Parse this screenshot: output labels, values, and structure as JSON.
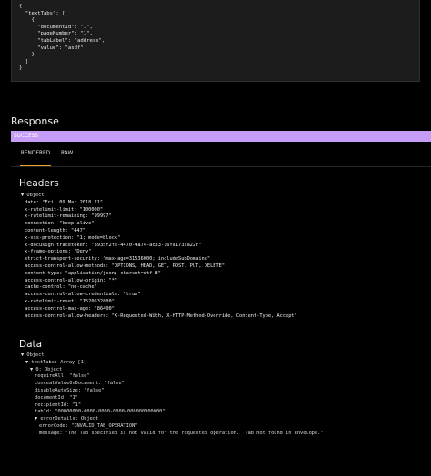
{
  "request_body": "{\n  \"textTabs\": [\n    {\n      \"documentId\": \"1\",\n      \"pageNumber\": \"1\",\n      \"tabLabel\": \"address\",\n      \"value\": \"asdf\"\n    }\n  ]\n}",
  "response": {
    "title": "Response",
    "status": "SUCCESS",
    "tabs": [
      {
        "label": "RENDERED"
      },
      {
        "label": "RAW"
      }
    ]
  },
  "headers": {
    "title": "Headers",
    "object_label": "▼ Object",
    "rows": [
      {
        "key": "date:",
        "value": "\"Fri, 09 Mar 2018 21\""
      },
      {
        "key": "x-ratelimit-limit:",
        "value": "\"100000\""
      },
      {
        "key": "x-ratelimit-remaining:",
        "value": "\"99997\""
      },
      {
        "key": "connection:",
        "value": "\"keep-alive\""
      },
      {
        "key": "content-length:",
        "value": "\"447\""
      },
      {
        "key": "x-xss-protection:",
        "value": "\"1; mode=block\""
      },
      {
        "key": "x-docusign-tracetoken:",
        "value": "\"3935f2fe-4470-4a74-ac33-16fa1732a22f\""
      },
      {
        "key": "x-frame-options:",
        "value": "\"Deny\""
      },
      {
        "key": "strict-transport-security:",
        "value": "\"max-age=31536000; includeSubDomains\""
      },
      {
        "key": "access-control-allow-methods:",
        "value": "\"OPTIONS, HEAD, GET, POST, PUT, DELETE\""
      },
      {
        "key": "content-type:",
        "value": "\"application/json; charset=utf-8\""
      },
      {
        "key": "access-control-allow-origin:",
        "value": "\"*\""
      },
      {
        "key": "cache-control:",
        "value": "\"no-cache\""
      },
      {
        "key": "access-control-allow-credentials:",
        "value": "\"true\""
      },
      {
        "key": "x-ratelimit-reset:",
        "value": "\"1520632800\""
      },
      {
        "key": "access-control-max-age:",
        "value": "\"86400\""
      },
      {
        "key": "access-control-allow-headers:",
        "value": "\"X-Requested-With, X-HTTP-Method-Override, Content-Type, Accept\""
      }
    ]
  },
  "data": {
    "title": "Data",
    "rows": [
      {
        "indent": 0,
        "text": "▼ Object"
      },
      {
        "indent": 1,
        "text": "▼ textTabs: Array [1]"
      },
      {
        "indent": 2,
        "text": "▼ 0: Object"
      },
      {
        "indent": 3,
        "text": "requireAll: \"false\""
      },
      {
        "indent": 3,
        "text": "concealValueOnDocument: \"false\""
      },
      {
        "indent": 3,
        "text": "disableAutoSize: \"false\""
      },
      {
        "indent": 3,
        "text": "documentId: \"1\""
      },
      {
        "indent": 3,
        "text": "recipientId: \"1\""
      },
      {
        "indent": 3,
        "text": "tabId: \"00000000-0000-0000-0000-000000000000\""
      },
      {
        "indent": 3,
        "text": "▼ errorDetails: Object"
      },
      {
        "indent": 4,
        "text": "errorCode: \"INVALID_TAB_OPERATION\""
      },
      {
        "indent": 4,
        "text": "message: \"The Tab specified is not valid for the requested operation.  Tab not found in envelope.\""
      }
    ]
  }
}
